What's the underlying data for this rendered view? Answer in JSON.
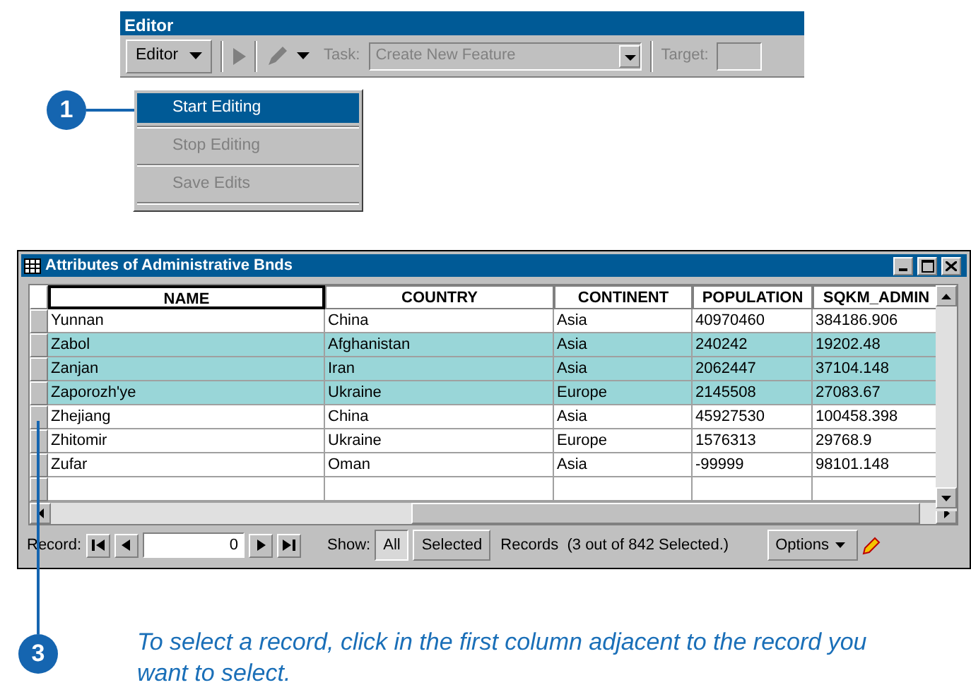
{
  "editor_toolbar": {
    "title": "Editor",
    "menu_button": "Editor",
    "task_label": "Task:",
    "task_value": "Create New Feature",
    "target_label": "Target:"
  },
  "editor_menu": {
    "items": [
      {
        "label": "Start Editing",
        "selected": true,
        "disabled": false
      },
      {
        "label": "Stop Editing",
        "selected": false,
        "disabled": true
      },
      {
        "label": "Save Edits",
        "selected": false,
        "disabled": true
      }
    ]
  },
  "callouts": [
    {
      "number": "1"
    },
    {
      "number": "3"
    }
  ],
  "attributes_window": {
    "title": "Attributes of Administrative Bnds",
    "table": {
      "columns": [
        "NAME",
        "COUNTRY",
        "CONTINENT",
        "POPULATION",
        "SQKM_ADMIN"
      ],
      "rows": [
        {
          "selected": false,
          "cells": [
            "Yunnan",
            "China",
            "Asia",
            "40970460",
            "384186.906"
          ]
        },
        {
          "selected": true,
          "cells": [
            "Zabol",
            "Afghanistan",
            "Asia",
            "240242",
            "19202.48"
          ]
        },
        {
          "selected": true,
          "cells": [
            "Zanjan",
            "Iran",
            "Asia",
            "2062447",
            "37104.148"
          ]
        },
        {
          "selected": true,
          "cells": [
            "Zaporozh'ye",
            "Ukraine",
            "Europe",
            "2145508",
            "27083.67"
          ]
        },
        {
          "selected": false,
          "cells": [
            "Zhejiang",
            "China",
            "Asia",
            "45927530",
            "100458.398"
          ]
        },
        {
          "selected": false,
          "cells": [
            "Zhitomir",
            "Ukraine",
            "Europe",
            "1576313",
            "29768.9"
          ]
        },
        {
          "selected": false,
          "cells": [
            "Zufar",
            "Oman",
            "Asia",
            "-99999",
            "98101.148"
          ]
        }
      ]
    },
    "footer": {
      "record_label": "Record:",
      "record_value": "0",
      "show_label": "Show:",
      "show_buttons": [
        {
          "label": "All",
          "selected": true
        },
        {
          "label": "Selected",
          "selected": false
        }
      ],
      "records_text": "Records  (3 out of 842 Selected.)",
      "options_button": "Options"
    }
  },
  "caption": "To select a record, click in the first column adjacent to the record you want to select."
}
